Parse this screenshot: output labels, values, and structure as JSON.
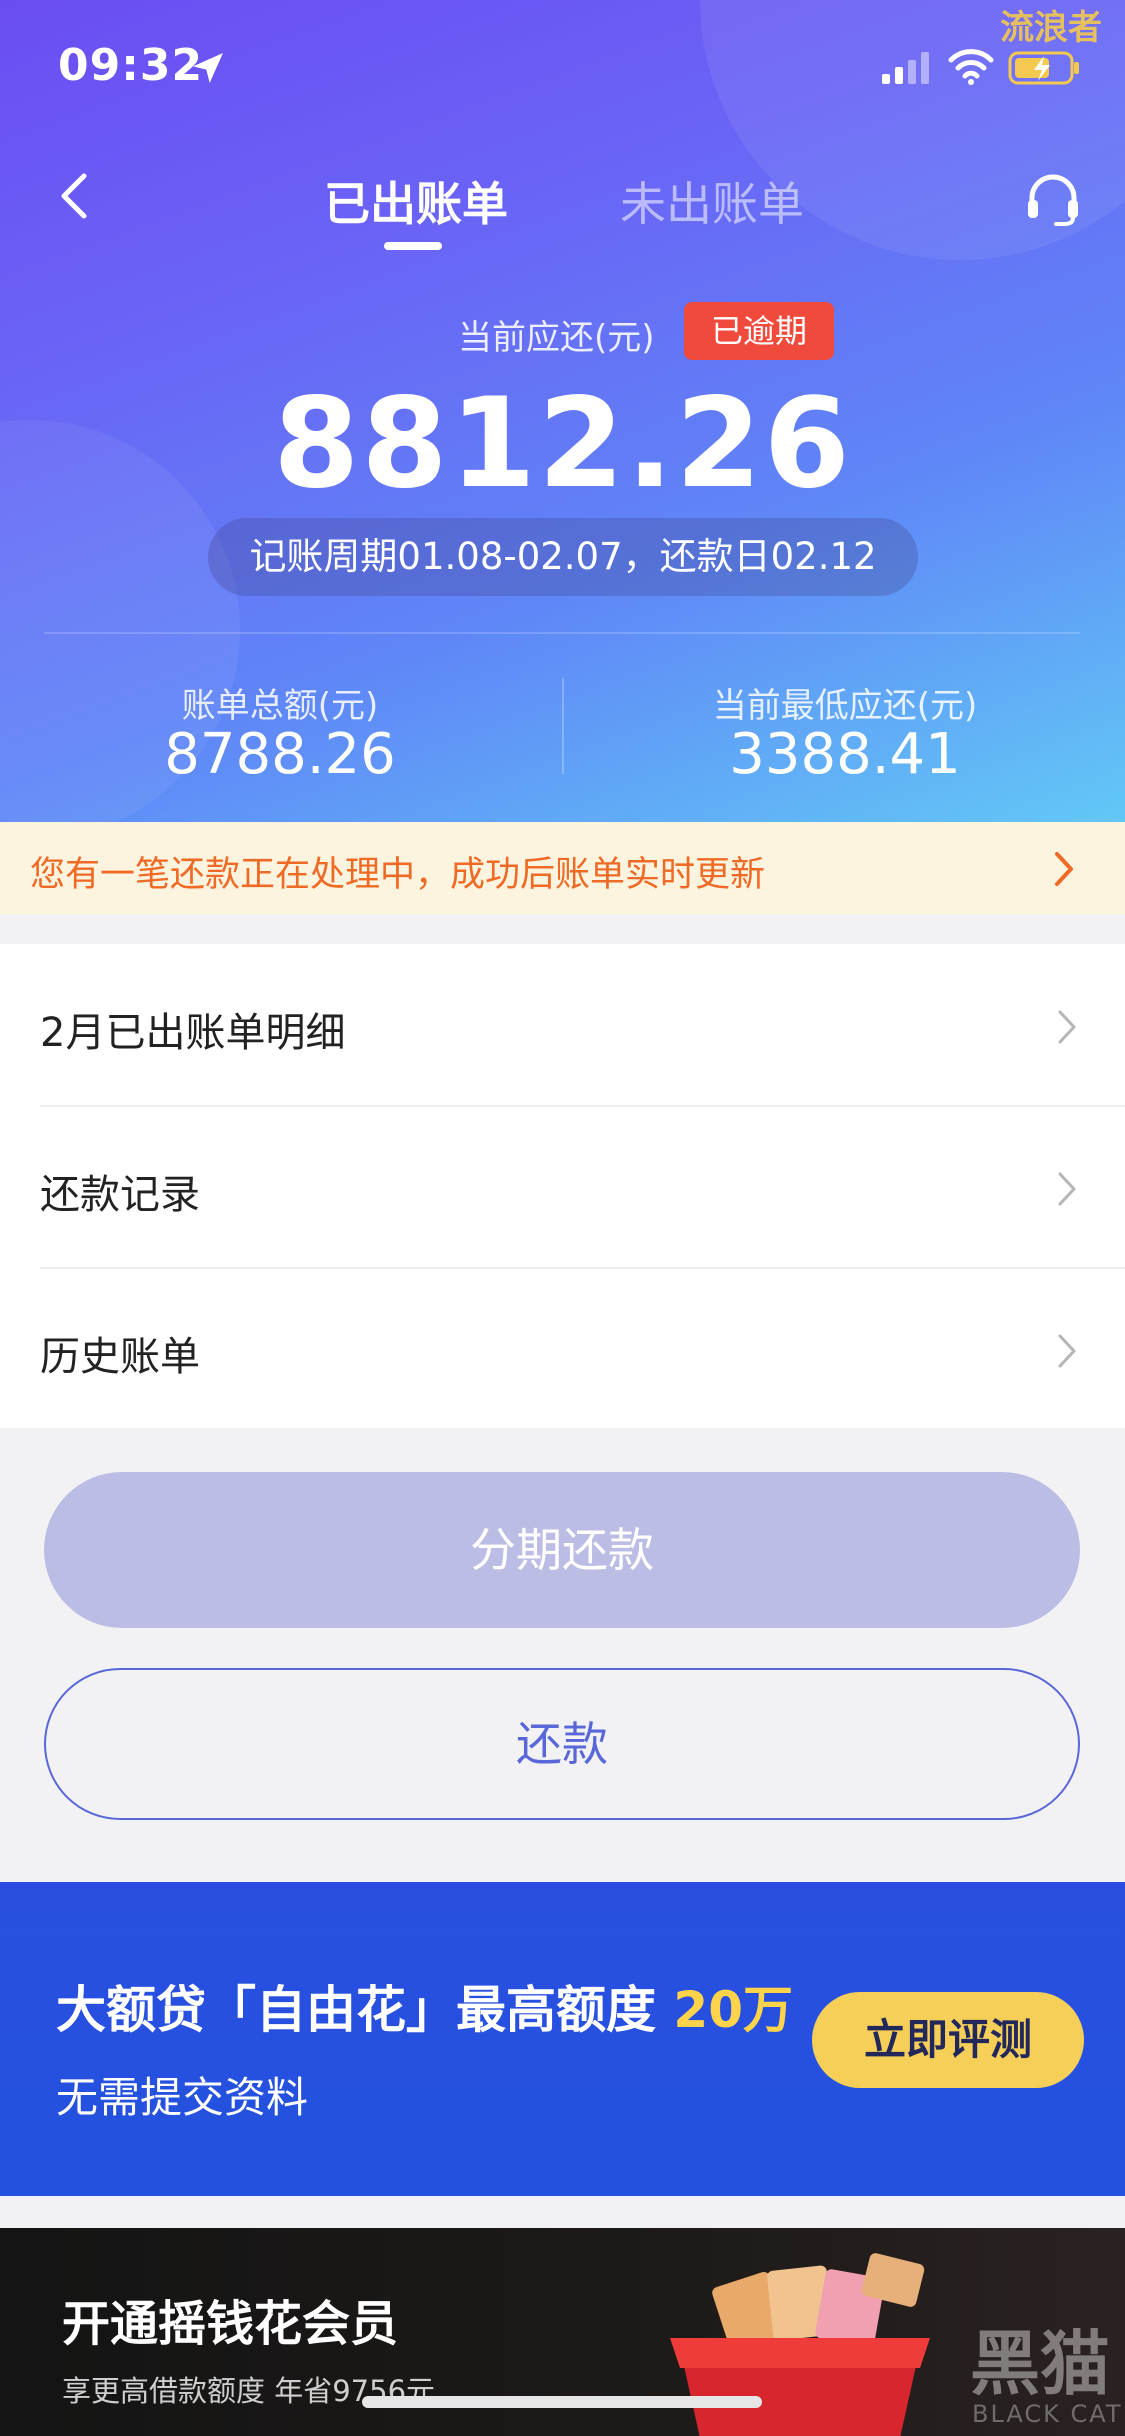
{
  "status_bar": {
    "time": "09:32",
    "watermark": "流浪者"
  },
  "header": {
    "tabs": [
      {
        "label": "已出账单",
        "active": true
      },
      {
        "label": "未出账单",
        "active": false
      }
    ]
  },
  "summary": {
    "due_label": "当前应还(元)",
    "overdue_badge": "已逾期",
    "due_amount": "8812.26",
    "cycle": "记账周期01.08-02.07，还款日02.12",
    "total_label": "账单总额(元)",
    "total_value": "8788.26",
    "min_label": "当前最低应还(元)",
    "min_value": "3388.41"
  },
  "notice": {
    "text": "您有一笔还款正在处理中，成功后账单实时更新"
  },
  "list": [
    {
      "label": "2月已出账单明细"
    },
    {
      "label": "还款记录"
    },
    {
      "label": "历史账单"
    }
  ],
  "buttons": {
    "installment": "分期还款",
    "repay": "还款"
  },
  "promo": {
    "title_prefix": "大额贷「自由花」最高额度",
    "title_highlight": "20万",
    "subtitle": "无需提交资料",
    "cta": "立即评测"
  },
  "member": {
    "title": "开通摇钱花会员",
    "subtitle": "享更高借款额度 年省9756元",
    "watermark": "黑猫",
    "watermark_sub": "BLACK CAT"
  },
  "colors": {
    "overdue": "#ef4a3c",
    "notice_text": "#ef6a24",
    "accent": "#5a67d8",
    "promo_highlight": "#ffd34a",
    "promo_cta": "#f6cf58"
  }
}
